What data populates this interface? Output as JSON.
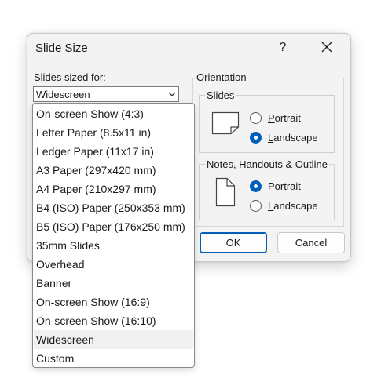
{
  "dialog": {
    "title": "Slide Size",
    "help_label": "?",
    "sized_for_label_accel": "S",
    "sized_for_label_rest": "lides sized for:",
    "selected_size": "Widescreen",
    "orientation_label": "Orientation",
    "slides_group_label": "Slides",
    "notes_group_label": "Notes, Handouts & Outline",
    "slides_portrait_accel": "P",
    "slides_portrait_rest": "ortrait",
    "slides_landscape_accel": "L",
    "slides_landscape_rest": "andscape",
    "notes_portrait_accel": "P",
    "notes_portrait_rest": "ortrait",
    "notes_landscape_accel": "L",
    "notes_landscape_rest": "andscape",
    "slides_orientation_selected": "Landscape",
    "notes_orientation_selected": "Portrait",
    "ok_label": "OK",
    "cancel_label": "Cancel"
  },
  "dropdown": {
    "items": [
      "On-screen Show (4:3)",
      "Letter Paper (8.5x11 in)",
      "Ledger Paper (11x17 in)",
      "A3 Paper (297x420 mm)",
      "A4 Paper (210x297 mm)",
      "B4 (ISO) Paper (250x353 mm)",
      "B5 (ISO) Paper (176x250 mm)",
      "35mm Slides",
      "Overhead",
      "Banner",
      "On-screen Show (16:9)",
      "On-screen Show (16:10)",
      "Widescreen",
      "Custom"
    ],
    "highlighted": "Widescreen"
  },
  "colors": {
    "accent": "#005fb8",
    "dialog_bg": "#f3f3f3",
    "highlight_bg": "#f0f0f0"
  }
}
